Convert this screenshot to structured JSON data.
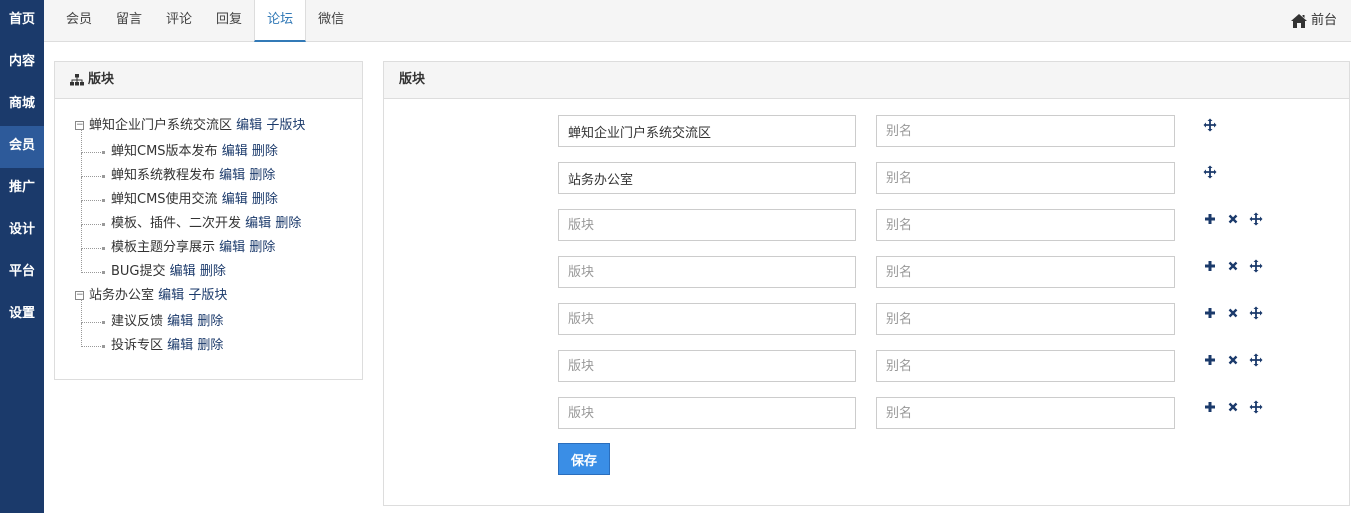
{
  "leftnav": {
    "items": [
      {
        "label": "首页"
      },
      {
        "label": "内容"
      },
      {
        "label": "商城"
      },
      {
        "label": "会员",
        "active": true
      },
      {
        "label": "推广"
      },
      {
        "label": "设计"
      },
      {
        "label": "平台"
      },
      {
        "label": "设置"
      }
    ]
  },
  "topbar": {
    "tabs": [
      {
        "label": "会员"
      },
      {
        "label": "留言"
      },
      {
        "label": "评论"
      },
      {
        "label": "回复"
      },
      {
        "label": "论坛",
        "active": true
      },
      {
        "label": "微信"
      }
    ],
    "front_label": "前台",
    "front_icon": "home-icon"
  },
  "tree_panel": {
    "title": "版块",
    "icon": "sitemap-icon",
    "edit_label": "编辑",
    "sub_label": "子版块",
    "delete_label": "删除",
    "groups": [
      {
        "name": "蝉知企业门户系统交流区",
        "children": [
          "蝉知CMS版本发布",
          "蝉知系统教程发布",
          "蝉知CMS使用交流",
          "模板、插件、二次开发",
          "模板主题分享展示",
          "BUG提交"
        ]
      },
      {
        "name": "站务办公室",
        "children": [
          "建议反馈",
          "投诉专区"
        ]
      }
    ]
  },
  "form_panel": {
    "title": "版块",
    "name_placeholder": "版块",
    "alias_placeholder": "别名",
    "rows": [
      {
        "name": "蝉知企业门户系统交流区",
        "alias": "",
        "icons": [
          "move-icon"
        ]
      },
      {
        "name": "站务办公室",
        "alias": "",
        "icons": [
          "move-icon"
        ]
      },
      {
        "name": "",
        "alias": "",
        "icons": [
          "plus-icon",
          "remove-icon",
          "move-icon"
        ]
      },
      {
        "name": "",
        "alias": "",
        "icons": [
          "plus-icon",
          "remove-icon",
          "move-icon"
        ]
      },
      {
        "name": "",
        "alias": "",
        "icons": [
          "plus-icon",
          "remove-icon",
          "move-icon"
        ]
      },
      {
        "name": "",
        "alias": "",
        "icons": [
          "plus-icon",
          "remove-icon",
          "move-icon"
        ]
      },
      {
        "name": "",
        "alias": "",
        "icons": [
          "plus-icon",
          "remove-icon",
          "move-icon"
        ]
      }
    ],
    "save_label": "保存"
  },
  "colors": {
    "nav_bg": "#1b3a6b",
    "nav_active": "#2d5a9a",
    "link": "#1b3a6b",
    "primary_button": "#3a8ee6",
    "tab_active": "#337ab7"
  }
}
